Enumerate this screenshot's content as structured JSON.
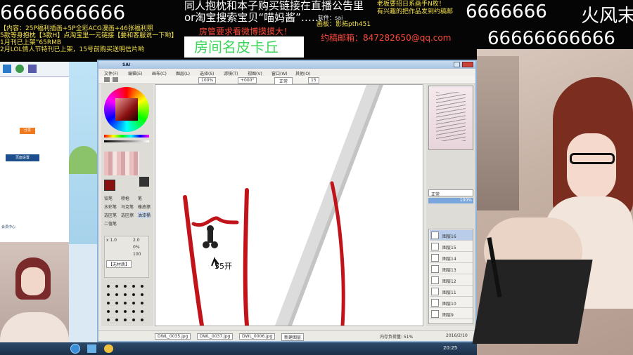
{
  "overlay": {
    "left_top": "6666666666",
    "center_line1": "同人抱枕和本子购买链接在直播公告里",
    "center_line2": "or淘宝搜索宝贝“喵妈酱”……",
    "center_small": "软件：sai",
    "notice": "房管要求看微博摸摸大！",
    "room_name": "房间名皮卡丘",
    "email": "约稿邮箱：847282650@qq.com",
    "right_top_a": "6666666",
    "right_top_b": "火风末",
    "right_second": "66666666666",
    "right_small1": "老板要招日系画手N枚！",
    "right_small2": "有兴趣的把作品发到约稿邮",
    "right_small3": "画板：影拓pth451",
    "left_lines": [
      "【内容：25P福利插画+5P全彩ACG漫画+46张福利照",
      "5款等身抱枕【3款H】点淘宝里一元链接【要和客服说一下哟】",
      "1月刊已上架”65RMB",
      "2月LOL情人节特刊已上架，15号前购买送明信片哟"
    ]
  },
  "sai": {
    "title": "SAI",
    "menu": [
      "文件(F)",
      "编辑(E)",
      "画布(C)",
      "图层(L)",
      "选择(S)",
      "滤镜(T)",
      "视图(V)",
      "窗口(W)",
      "其他(O)"
    ],
    "toolbar_zoom": "100%",
    "toolbar_angle": "+000°",
    "toolbar_mode": "正常",
    "toolbar_stab": "15",
    "canvas_text": "55开",
    "tools": [
      "铅笔",
      "喷枪",
      "笔",
      "水彩笔",
      "马克笔",
      "橡皮擦",
      "选区笔",
      "选区擦",
      "油漆桶",
      "二值笔"
    ],
    "brush_size": "x 1.0",
    "brush_size_val": "2.0",
    "min_size": "0%",
    "density": "100",
    "texture": "【无材质】",
    "tabs": [
      "DWL_0035.jpg",
      "DWL_0037.jpg",
      "DWL_0006.jpg",
      "新建图层"
    ],
    "status": "内存负荷量: 51%",
    "layer_mode": "正常",
    "opacity": "100%",
    "layers": [
      "图层16",
      "图层15",
      "图层14",
      "图层13",
      "图层12",
      "图层11",
      "图层10",
      "图层9"
    ],
    "date": "2016/2/10"
  },
  "left_desktop": {
    "btn_orange": "分享",
    "panel_label": "页面设置",
    "link": "会员中心"
  },
  "taskbar": {
    "time": "20:25"
  },
  "colors": {
    "stroke_red": "#c0141a",
    "stroke_gray": "#c8c8c8",
    "sai_border": "#8fb3d8",
    "title_green": "#3cd65a",
    "title_red": "#ff4a3a"
  }
}
